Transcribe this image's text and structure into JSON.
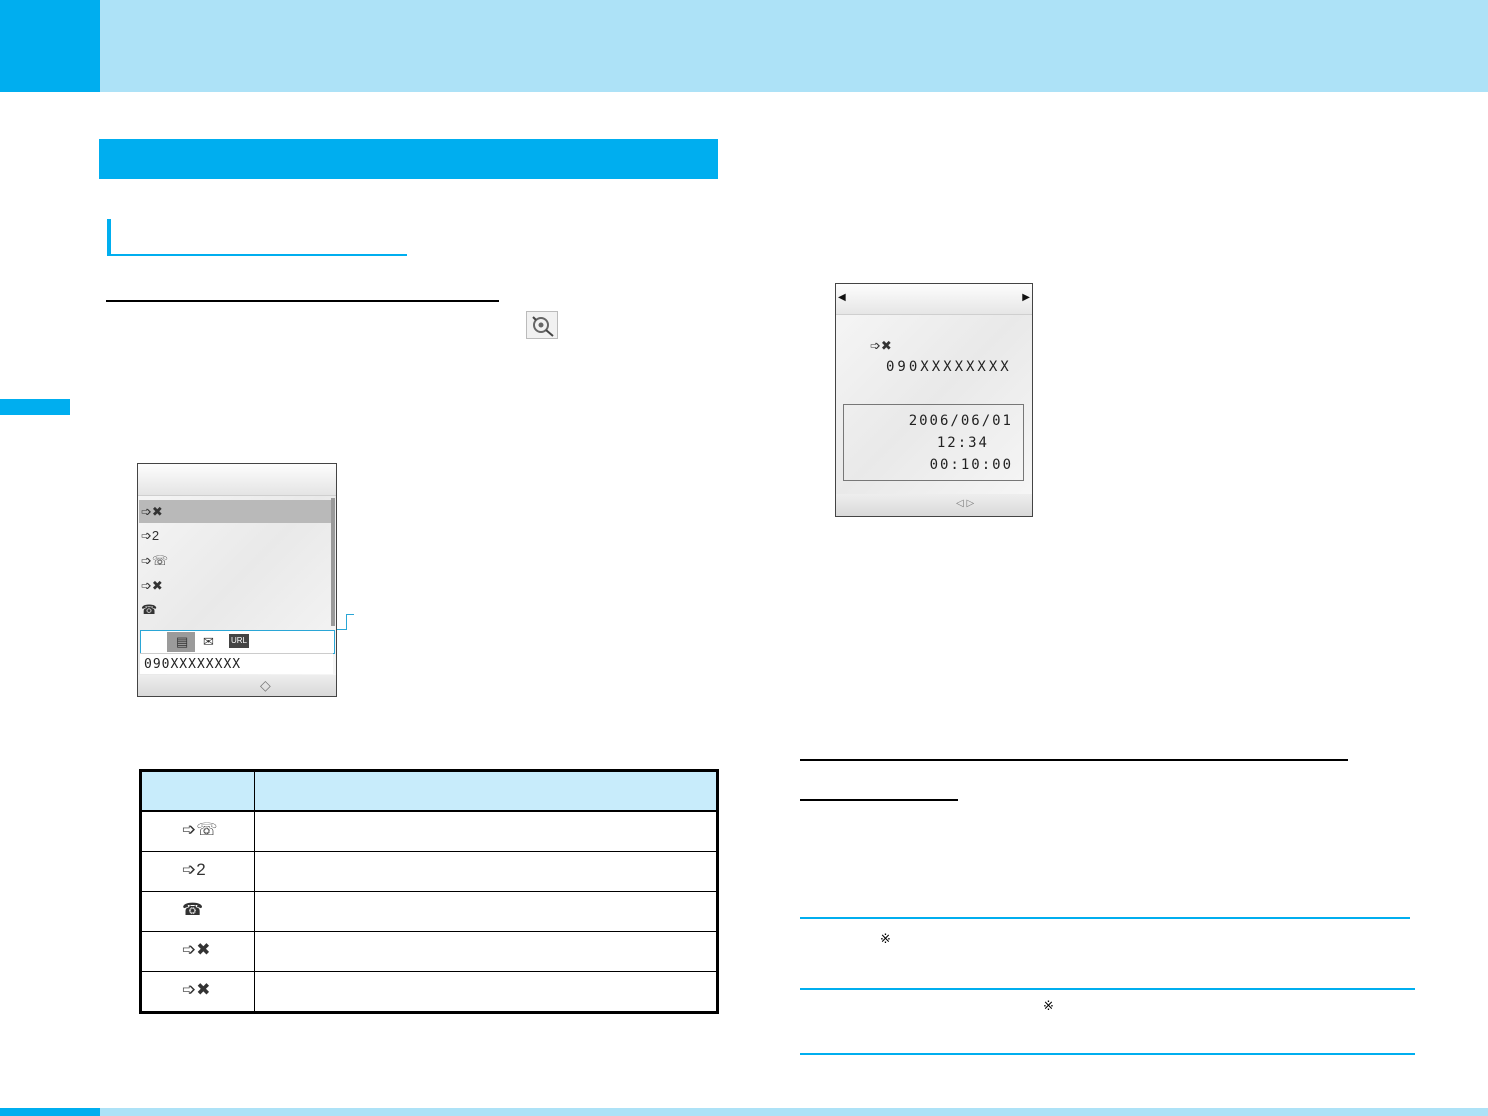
{
  "screen1": {
    "rows": [
      {
        "icon": "call-forwarded-icon"
      },
      {
        "icon": "call-two-icon"
      },
      {
        "icon": "call-icon"
      },
      {
        "icon": "call-blocked-icon"
      },
      {
        "icon": "call-end-icon"
      }
    ],
    "iconbar": {
      "url_badge": "URL"
    },
    "number": "090XXXXXXXX",
    "nav_glyph": "◇"
  },
  "screen2": {
    "number": "090XXXXXXXX",
    "date": "2006/06/01",
    "time": "12:34",
    "duration": "00:10:00",
    "arrow_left": "◀",
    "arrow_right": "▶",
    "nav_glyph": "◁ ▷"
  },
  "icon_table": {
    "rows": [
      {
        "icon": "call-icon"
      },
      {
        "icon": "call-two-icon"
      },
      {
        "icon": "call-end-icon"
      },
      {
        "icon": "call-blocked-icon"
      },
      {
        "icon": "call-forwarded-icon"
      }
    ]
  },
  "notes": {
    "ref_mark_1": "※",
    "ref_mark_2": "※"
  },
  "colors": {
    "accent": "#00aeef",
    "band": "#ade2f7",
    "table_header": "#c8ecfb"
  }
}
